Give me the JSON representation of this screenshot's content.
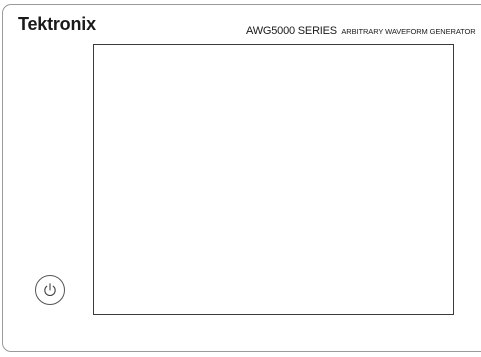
{
  "header": {
    "brand": "Tektronix",
    "model_main": "AWG5000 SERIES",
    "model_sub": "ARBITRARY WAVEFORM GENERATOR"
  },
  "icons": {
    "power": "power-icon"
  }
}
